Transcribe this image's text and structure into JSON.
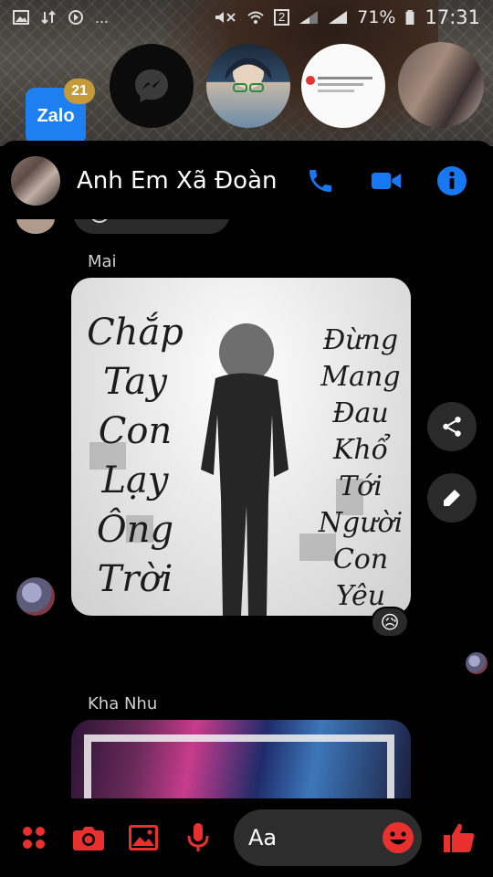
{
  "status_bar": {
    "battery": "71%",
    "time": "17:31",
    "sim_slot": "2",
    "more": "..."
  },
  "chat_heads": {
    "zalo_label": "Zalo",
    "zalo_badge": "21"
  },
  "header": {
    "title": "Anh Em Xã Đoàn"
  },
  "messages": [
    {
      "sender": "Mai",
      "type": "image",
      "image_text_left": [
        "Chắp",
        "Tay",
        "Con",
        "Lạy",
        "Ông",
        "Trời"
      ],
      "image_text_right": [
        "Đừng",
        "Mang",
        "Đau",
        "Khổ",
        "Tới",
        "Người",
        "Con",
        "Yêu"
      ],
      "reaction": "😥"
    },
    {
      "sender": "Kha Nhu",
      "type": "image"
    }
  ],
  "composer": {
    "placeholder": "Aa"
  },
  "colors": {
    "accent_blue": "#1877f2",
    "accent_red": "#e8312f"
  }
}
